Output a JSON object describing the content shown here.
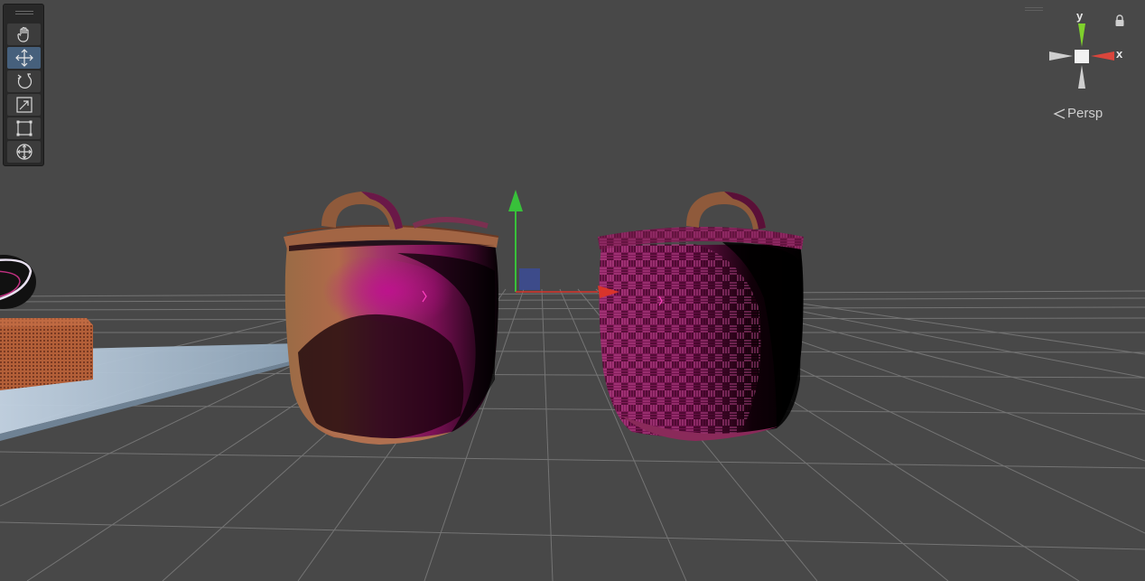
{
  "toolbar": {
    "tools": [
      {
        "name": "hand-tool",
        "icon": "hand-icon",
        "active": false
      },
      {
        "name": "move-tool",
        "icon": "move-arrows-icon",
        "active": true
      },
      {
        "name": "rotate-tool",
        "icon": "rotate-icon",
        "active": false
      },
      {
        "name": "scale-tool",
        "icon": "scale-icon",
        "active": false
      },
      {
        "name": "rect-tool",
        "icon": "rect-transform-icon",
        "active": false
      },
      {
        "name": "transform-tool",
        "icon": "transform-all-icon",
        "active": false
      }
    ]
  },
  "gizmo": {
    "y_label": "y",
    "x_label": "x",
    "projection": "Persp",
    "colors": {
      "y": "#7fd12c",
      "x": "#d9463c",
      "neutral": "#cfcfcf"
    }
  },
  "scene": {
    "grid_color": "#8a8a8a",
    "background": "#484848",
    "objects": [
      "clay-pot",
      "woven-pot",
      "table-plane",
      "wicker-box",
      "bowl"
    ],
    "move_handle_colors": {
      "y": "#38c13a",
      "x": "#d9342b",
      "plane": "#3c4c96"
    }
  }
}
